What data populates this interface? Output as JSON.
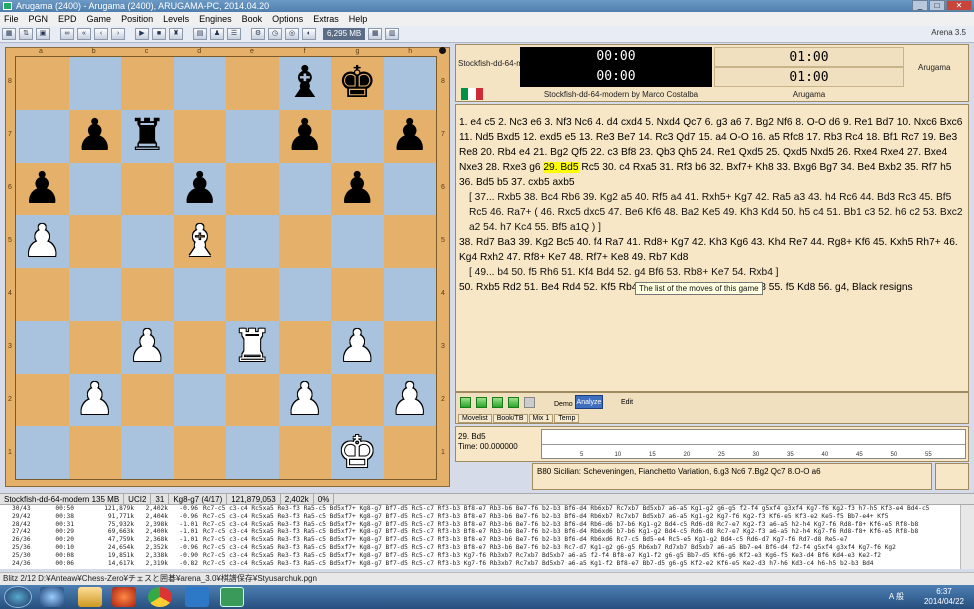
{
  "window": {
    "title": "Arugama (2400)  - Arugama (2400),    ARUGAMA-PC,  2014.04.20",
    "buttons": {
      "minimize": "_",
      "maximize": "□",
      "close": "✕"
    }
  },
  "menu": [
    "File",
    "PGN",
    "EPD",
    "Game",
    "Position",
    "Levels",
    "Engines",
    "Book",
    "Options",
    "Extras",
    "Help"
  ],
  "toolbar": {
    "memory": "6,295 MB",
    "version": "Arena 3.5"
  },
  "board": {
    "files": [
      "a",
      "b",
      "c",
      "d",
      "e",
      "f",
      "g",
      "h"
    ],
    "ranks": [
      "8",
      "7",
      "6",
      "5",
      "4",
      "3",
      "2",
      "1"
    ],
    "pieces": [
      {
        "sq": "f8",
        "piece": "bishop",
        "color": "black"
      },
      {
        "sq": "g8",
        "piece": "king",
        "color": "black"
      },
      {
        "sq": "b7",
        "piece": "pawn",
        "color": "black"
      },
      {
        "sq": "c7",
        "piece": "rook",
        "color": "black"
      },
      {
        "sq": "f7",
        "piece": "pawn",
        "color": "black"
      },
      {
        "sq": "h7",
        "piece": "pawn",
        "color": "black"
      },
      {
        "sq": "a6",
        "piece": "pawn",
        "color": "black"
      },
      {
        "sq": "d6",
        "piece": "pawn",
        "color": "black"
      },
      {
        "sq": "g6",
        "piece": "pawn",
        "color": "black"
      },
      {
        "sq": "a5",
        "piece": "pawn",
        "color": "white"
      },
      {
        "sq": "d5",
        "piece": "bishop",
        "color": "white"
      },
      {
        "sq": "c3",
        "piece": "pawn",
        "color": "white"
      },
      {
        "sq": "e3",
        "piece": "rook",
        "color": "white"
      },
      {
        "sq": "g3",
        "piece": "pawn",
        "color": "white"
      },
      {
        "sq": "b2",
        "piece": "pawn",
        "color": "white"
      },
      {
        "sq": "f2",
        "piece": "pawn",
        "color": "white"
      },
      {
        "sq": "h2",
        "piece": "pawn",
        "color": "white"
      },
      {
        "sq": "g1",
        "piece": "king",
        "color": "white"
      }
    ]
  },
  "clocks": {
    "white_engine": "Stockfish-dd-64-mode",
    "black_clock_1": "00:00",
    "black_clock_2": "00:00",
    "white_clock_1": "01:00",
    "white_clock_2": "01:00",
    "opponent": "Arugama",
    "engine_full_name": "Stockfish-dd-64-modern by Marco Costalba",
    "opponent_full": "Arugama"
  },
  "moves": {
    "main1": "1. e4 c5 2. Nc3 e6 3. Nf3 Nc6 4. d4 cxd4 5. Nxd4 Qc7 6. g3 a6 7. Bg2 Nf6 8. O-O d6 9. Re1 Bd7 10. Nxc6 Bxc6 11. Nd5 Bxd5 12. exd5 e5 13. Re3 Be7 14. Rc3 Qd7 15. a4 O-O 16. a5 Rfc8 17. Rb3 Rc4 18. Bf1 Rc7 19. Be3 Re8 20. Rb4 e4 21. Bg2 Qf5 22. c3 Bf8 23. Qb3 Qh5 24. Re1 Qxd5 25. Qxd5 Nxd5 26. Rxe4 Rxe4 27. Bxe4 Nxe3 28. Rxe3 g6 ",
    "current": "29. Bd5",
    "main2": " Rc5 30. c4 Rxa5 31. Rf3 b6 32. Bxf7+ Kh8 33. Bxg6 Bg7 34. Be4 Bxb2 35. Rf7 h5 36. Bd5 b5 37. cxb5 axb5",
    "var1": "[ 37... Rxb5 38. Bc4 Rb6 39. Kg2 a5 40. Rf5 a4 41. Rxh5+ Kg7 42. Ra5 a3 43. h4 Rc6 44. Bd3 Rc3 45. Bf5 Rc5 46. Ra7+ ( 46. Rxc5 dxc5 47. Be6 Kf6 48. Ba2 Ke5 49. Kh3 Kd4 50. h5 c4 51. Bb1 c3 52. h6 c2 53. Bxc2 a2 54. h7 Kc4 55. Bf5 a1Q ) ]",
    "main3": "38. Rd7 Ba3 39. Kg2 Bc5 40. f4 Ra7 41. Rd8+ Kg7 42. Kh3 Kg6 43. Kh4 Re7 44. Rg8+ Kf6 45. Kxh5 Rh7+ 46. Kg4 Rxh2 47. Rf8+ Ke7 48. Rf7+ Ke8 49. Rb7 Kd8",
    "var2": "[ 49... b4 50. f5 Rh6 51. Kf4 Bd4 52. g4 Bf6 53. Rb8+ Ke7 54. Rxb4 ]",
    "main4": "50. Rxb5 Rd2 51. Be4 Rd4 52. Kf5 Rb4 53. Rxb4 Bxb4 54. Ke6 Ke8 55. f5 Kd8 56. g4, Black resigns",
    "tooltip": "The list of the moves of this game"
  },
  "nav": {
    "demo": "Demo",
    "analyze": "Analyze",
    "edit": "Edit",
    "tabs": [
      "Movelist",
      "Book/TB",
      "Mix 1",
      "Temp"
    ]
  },
  "graph": {
    "move": "29. Bd5",
    "time": "Time: 00.000000",
    "ticks": [
      "5",
      "10",
      "15",
      "20",
      "25",
      "30",
      "35",
      "40",
      "45",
      "50",
      "55"
    ]
  },
  "opening": "B80  Sicilian: Scheveningen, Fianchetto Variation, 6.g3 Nc6 7.Bg2 Qc7 8.O-O a6",
  "engine_bar": [
    "Stockfish-dd-64-modern  135 MB",
    "UCI2",
    "31",
    "Kg8-g7 (4/17)",
    "121,879,053",
    "2,402k",
    "0%"
  ],
  "engine_lines": [
    [
      "30/43",
      "00:50",
      "121,879k",
      "2,402k",
      "-0.96",
      "Rc7-c5  c3-c4  Rc5xa5  Re3-f3  Ra5-c5  Bd5xf7+ Kg8-g7  Bf7-d5  Rc5-c7  Rf3-b3  Bf8-e7  Rb3-b6  Be7-f6  b2-b3  Bf6-d4  Rb6xb7  Rc7xb7  Bd5xb7  a6-a5  Kg1-g2  g6-g5  f2-f4  g5xf4  g3xf4  Kg7-f6  Kg2-f3  h7-h5  Kf3-e4  Bd4-c5"
    ],
    [
      "29/42",
      "00:38",
      "91,771k",
      "2,404k",
      "-0.96",
      "Rc7-c5  c3-c4  Rc5xa5  Re3-f3  Ra5-c5  Bd5xf7+ Kg8-g7  Bf7-d5  Rc5-c7  Rf3-b3  Bf8-e7  Rb3-b6  Be7-f6  b2-b3  Bf6-d4  Rb6xb7  Rc7xb7  Bd5xb7  a6-a5  Kg1-g2  Kg7-f6  Kg2-f3  Kf6-e5  Kf3-e2  Ke5-f5  Bb7-e4+ Kf5"
    ],
    [
      "28/42",
      "00:31",
      "75,932k",
      "2,398k",
      "-1.01",
      "Rc7-c5  c3-c4  Rc5xa5  Re3-f3  Ra5-c5  Bd5xf7+ Kg8-g7  Bf7-d5  Rc5-c7  Rf3-b3  Bf8-e7  Rb3-b6  Be7-f6  b2-b3  Bf6-d4  Rb6-d6  b7-b6  Kg1-g2  Bd4-c5  Rd6-d8  Rc7-e7  Kg2-f3  a6-a5  h2-h4  Kg7-f6  Rd8-f8+ Kf6-e5  Rf8-b8"
    ],
    [
      "27/42",
      "00:29",
      "69,663k",
      "2,400k",
      "-1.01",
      "Rc7-c5  c3-c4  Rc5xa5  Re3-f3  Ra5-c5  Bd5xf7+ Kg8-g7  Bf7-d5  Rc5-c7  Rf3-b3  Bf8-e7  Rb3-b6  Be7-f6  b2-b3  Bf6-d4  Rb6xd6  b7-b6  Kg1-g2  Bd4-c5  Rd6-d8  Rc7-e7  Kg2-f3  a6-a5  h2-h4  Kg7-f6  Rd8-f8+ Kf6-e5  Rf8-b8"
    ],
    [
      "26/36",
      "00:20",
      "47,759k",
      "2,368k",
      "-1.01",
      "Rc7-c5  c3-c4  Rc5xa5  Re3-f3  Ra5-c5  Bd5xf7+ Kg8-g7  Bf7-d5  Rc5-c7  Rf3-b3  Bf8-e7  Rb3-b6  Be7-f6  b2-b3  Bf6-d4  Rb6xd6  Rc7-c5  Bd5-e4  Rc5-e5  Kg1-g2  Bd4-c5  Rd6-d7  Kg7-f6  Rd7-d8  Re5-e7"
    ],
    [
      "25/36",
      "00:10",
      "24,654k",
      "2,352k",
      "-0.96",
      "Rc7-c5  c3-c4  Rc5xa5  Re3-f3  Ra5-c5  Bd5xf7+ Kg8-g7  Bf7-d5  Rc5-c7  Rf3-b3  Bf8-e7  Rb3-b6  Be7-f6  b2-b3  Rc7-d7  Kg1-g2  g6-g5  Rb6xb7  Rd7xb7  Bd5xb7  a6-a5  Bb7-e4  Bf6-d4  f2-f4  g5xf4  g3xf4  Kg7-f6  Kg2"
    ],
    [
      "25/30",
      "00:08",
      "19,851k",
      "2,338k",
      "-0.90",
      "Rc7-c5  c3-c4  Rc5xa5  Re3-f3  Ra5-c5  Bd5xf7+ Kg8-g7  Bf7-d5  Rc5-c7  Rf3-b3  Kg7-f6  Rb3xb7  Rc7xb7  Bd5xb7  a6-a5  f2-f4  Bf8-e7  Kg1-f2  g6-g5  Bb7-d5  Kf6-g6  Kf2-e3  Kg6-f5  Ke3-d4  Bf6  Kd4-e3  Ke2-f2"
    ],
    [
      "24/36",
      "00:06",
      "14,617k",
      "2,319k",
      "-0.82",
      "Rc7-c5  c3-c4  Rc5xa5  Re3-f3  Ra5-c5  Bd5xf7+ Kg8-g7  Bf7-d5  Rc5-c7  Rf3-b3  Kg7-f6  Rb3xb7  Rc7xb7  Bd5xb7  a6-a5  Kg1-f2  Bf8-e7  Bb7-d5  g6-g5  Kf2-e2  Kf6-e5  Ke2-d3  h7-h6  Kd3-c4  h6-h5  b2-b3  Bd4"
    ]
  ],
  "status": "Blitz 2/12    D:¥Anteaw¥Chess-Zero¥チェスと囲碁¥arena_3.0¥棋譜保存¥Styusarchuk.pgn",
  "taskbar": {
    "time": "6:37",
    "date": "2014/04/22",
    "tray": "A 般"
  }
}
